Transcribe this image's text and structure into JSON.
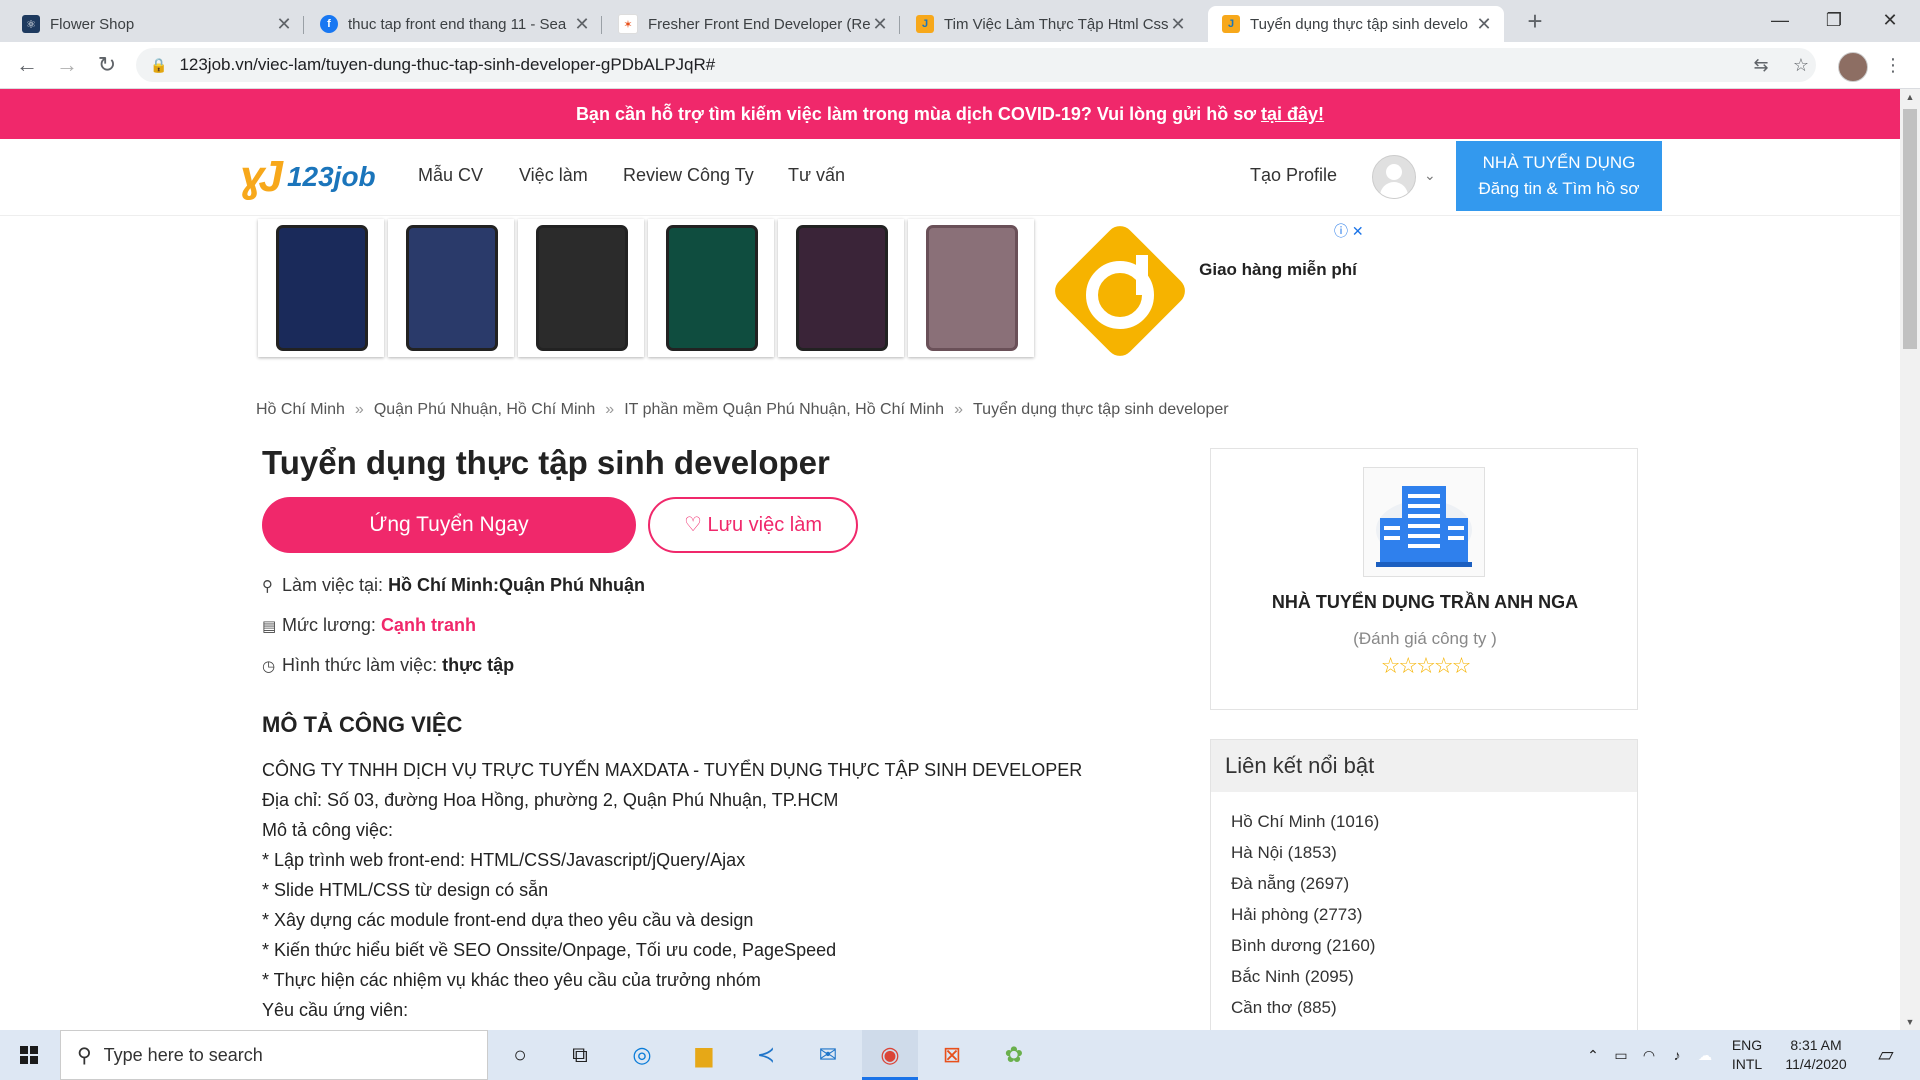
{
  "browser": {
    "tabs": [
      {
        "title": "Flower Shop",
        "favicon_color": "#1e3a5f",
        "favicon_glyph": "⚛",
        "active": false
      },
      {
        "title": "thuc tap front end thang 11 - Sea",
        "favicon_color": "#1877f2",
        "favicon_glyph": "f",
        "active": false
      },
      {
        "title": "Fresher Front End Developer (Rea",
        "favicon_color": "#ffffff",
        "favicon_glyph": "✶",
        "active": false
      },
      {
        "title": "Tim Việc Làm Thực Tập Html Css",
        "favicon_color": "#1b75bb",
        "favicon_glyph": "J",
        "active": false
      },
      {
        "title": "Tuyển dụng thực tập sinh develo",
        "favicon_color": "#1b75bb",
        "favicon_glyph": "J",
        "active": true
      }
    ],
    "new_tab": "+",
    "url": "123job.vn/viec-lam/tuyen-dung-thuc-tap-sinh-developer-gPDbALPJqR#"
  },
  "banner": {
    "text": "Bạn cần hỗ trợ tìm kiếm việc làm trong mùa dịch COVID-19? Vui lòng gửi hồ sơ ",
    "link": "tại đây!"
  },
  "header": {
    "logo_text": "123job",
    "nav": [
      "Mẫu CV",
      "Việc làm",
      "Review Công Ty",
      "Tư vấn"
    ],
    "create_profile": "Tạo Profile",
    "employer_line1": "NHÀ TUYỂN DỤNG",
    "employer_line2": "Đăng tin & Tìm hồ sơ"
  },
  "ad": {
    "text": "Giao hàng miễn phí",
    "phone_colors": [
      "#1a2a5a",
      "#2a3a6a",
      "#2b2b2b",
      "#0f4d3f",
      "#3a2438",
      "#8a7078"
    ],
    "accent": "#f6b300"
  },
  "breadcrumb": [
    "Hồ Chí Minh",
    "Quận Phú Nhuận, Hồ Chí Minh",
    "IT phần mềm Quận Phú Nhuận, Hồ Chí Minh",
    "Tuyển dụng thực tập sinh developer"
  ],
  "job": {
    "title": "Tuyển dụng thực tập sinh developer",
    "apply_label": "Ứng Tuyển Ngay",
    "save_label": "Lưu việc làm",
    "location_label": "Làm việc tại:",
    "location_value": "Hồ Chí Minh:Quận Phú Nhuận",
    "salary_label": "Mức lương:",
    "salary_value": "Cạnh tranh",
    "type_label": "Hình thức làm việc:",
    "type_value": "thực tập",
    "section_title": "MÔ TẢ CÔNG VIỆC",
    "description": [
      "CÔNG TY TNHH DỊCH VỤ TRỰC TUYẾN MAXDATA - TUYỂN DỤNG THỰC TẬP SINH DEVELOPER",
      "Địa chỉ: Số 03, đường Hoa Hồng, phường 2, Quận Phú Nhuận, TP.HCM",
      "Mô tả công việc:",
      "* Lập trình web front-end: HTML/CSS/Javascript/jQuery/Ajax",
      "* Slide HTML/CSS từ design có sẵn",
      "* Xây dựng các module front-end dựa theo yêu cầu và design",
      "* Kiến thức hiểu biết về SEO Onssite/Onpage, Tối ưu code, PageSpeed",
      "* Thực hiện các nhiệm vụ khác theo yêu cầu của trưởng nhóm",
      "Yêu cầu ứng viên:"
    ]
  },
  "company": {
    "name": "NHÀ TUYỂN DỤNG TRẦN ANH NGA",
    "rating_label": "(Đánh giá công ty )",
    "stars": "☆☆☆☆☆",
    "rating": 0
  },
  "links": {
    "title": "Liên kết nổi bật",
    "items": [
      "Hồ Chí Minh (1016)",
      "Hà Nội (1853)",
      "Đà nẵng (2697)",
      "Hải phòng (2773)",
      "Bình dương (2160)",
      "Bắc Ninh (2095)",
      "Cần thơ (885)"
    ]
  },
  "taskbar": {
    "search_placeholder": "Type here to search",
    "lang_line1": "ENG",
    "lang_line2": "INTL",
    "time": "8:31 AM",
    "date": "11/4/2020"
  }
}
